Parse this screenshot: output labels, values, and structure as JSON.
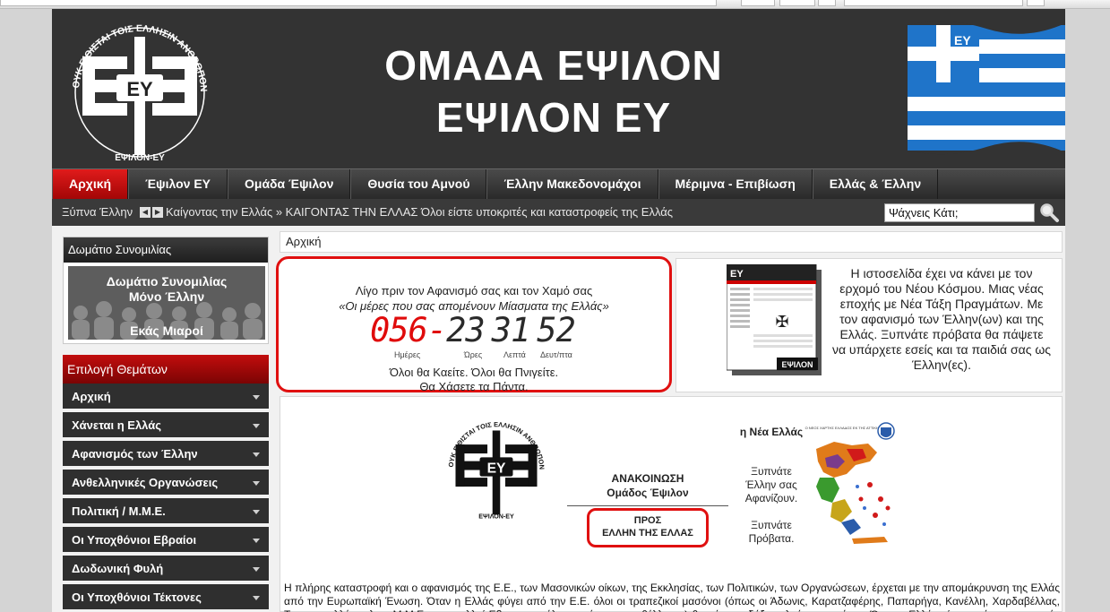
{
  "site": {
    "title_line1": "ΟΜΑΔΑ ΕΨΙΛΟΝ",
    "title_line2": "ΕΨΙΛΟΝ ΕΥ",
    "logo_text": "ΟΥΚ ΕΙΘΙΣΤΑΙ ΤΟΙΣ ΕΛΛΗΣΙΝ ΑΝΘΡΩΠΟΝ ΠΡΟΣΚΥΝΕΕΙ",
    "logo_bottom": "ΕΨΙΛΟΝ-ΕΥ",
    "logo_mark": "ΕΥ",
    "flag_mark": "ΕΥ"
  },
  "colors": {
    "header_bg": "#333333",
    "accent_red": "#d40f0f",
    "flag_blue": "#1f74c9",
    "nav_bg": "#2a2a2a"
  },
  "nav": {
    "items": [
      {
        "label": "Αρχική",
        "active": true
      },
      {
        "label": "Έψιλον ΕΥ",
        "active": false
      },
      {
        "label": "Ομάδα Έψιλον",
        "active": false
      },
      {
        "label": "Θυσία του Αμνού",
        "active": false
      },
      {
        "label": "Έλλην Μακεδονομάχοι",
        "active": false
      },
      {
        "label": "Μέριμνα - Επιβίωση",
        "active": false
      },
      {
        "label": "Ελλάς & Έλλην",
        "active": false
      }
    ]
  },
  "ticker": {
    "label": "Ξύπνα Έλλην",
    "text": "Καίγοντας την Ελλάς » ΚΑΙΓΟΝΤΑΣ ΤΗΝ ΕΛΛΑΣ Όλοι είστε υποκριτές και καταστροφείς της Ελλάς",
    "prev_icon": "arrow-left-icon",
    "next_icon": "arrow-right-icon"
  },
  "search": {
    "value": "Ψάχνεις Κάτι;",
    "icon": "magnifier-icon"
  },
  "chat": {
    "heading": "Δωμάτιο Συνομιλίας",
    "banner_line1": "Δωμάτιο Συνομιλίας",
    "banner_line2": "Μόνο Έλλην",
    "banner_line3": "Εκάς Μιαροί"
  },
  "topics": {
    "heading": "Επιλογή Θεμάτων",
    "items": [
      {
        "label": "Αρχική"
      },
      {
        "label": "Χάνεται η Ελλάς"
      },
      {
        "label": "Αφανισμός των Έλλην"
      },
      {
        "label": "Ανθελληνικές Οργανώσεις"
      },
      {
        "label": "Πολιτική / Μ.Μ.Ε."
      },
      {
        "label": "Οι Υποχθόνιοι Εβραίοι"
      },
      {
        "label": "Δωδωνική Φυλή"
      },
      {
        "label": "Οι Υποχθόνιοι Τέκτονες"
      }
    ]
  },
  "breadcrumb": "Αρχική",
  "countdown": {
    "line1": "Λίγο πριν τον Αφανισμό σας και τον Χαμό σας",
    "line2": "«Οι μέρες που σας απομένουν Μίασματα της Ελλάς»",
    "days": "056",
    "dash": "-",
    "hours": "23",
    "minutes": "31",
    "seconds": "52",
    "unit_days": "Ημέρες",
    "unit_hours": "Ώρες",
    "unit_minutes": "Λεπτά",
    "unit_seconds": "Δευτ/πτα",
    "line3": "Όλοι θα Καείτε. Όλοι θα Πνιγείτε.",
    "line4": "Θα Χάσετε τα Πάντα."
  },
  "intro": {
    "text": "Η ιστοσελίδα έχει να κάνει με τον ερχομό του Νέου Κόσμου. Μιας νέας εποχής με Νέα Τάξη Πραγμάτων. Με τον αφανισμό των Έλλην(ων) και της Ελλάς. Ξυπνάτε πρόβατα θα πάψετε να υπάρχετε εσείς και τα παιδιά σας ως Έλλην(ες).",
    "thumb_label": "ΕΨΙΛΟΝ",
    "thumb_mark": "ΕΥ"
  },
  "announcement": {
    "title": "ΑΝΑΚΟΙΝΩΣΗ",
    "subtitle": "Ομάδος Έψιλον",
    "to_line1": "ΠΡΟΣ",
    "to_line2": "ΕΛΛΗΝ ΤΗΣ ΕΛΛΑΣ"
  },
  "map_side": {
    "line1": "η Νέα Ελλάς",
    "line2": "Ξυπνάτε Έλλην σας Αφανίζουν.",
    "line3": "Ξυπνάτε Πρόβατα.",
    "map_caption": "Ο ΝΕΟΣ ΧΑΡΤΗΣ ΕΛΛΑΔΟΣ ΕΚ ΤΗΣ ΑΤΤΙΚΗΣ"
  },
  "article": "Η πλήρης καταστροφή και ο αφανισμός της Ε.Ε., των Μασονικών οίκων, της Εκκλησίας, των Πολιτικών, των Οργανώσεων, έρχεται με την απομάκρυνση της Ελλάς από την Ευρωπαϊκή Ένωση. Όταν η Ελλάς φύγει από την Ε.Ε. όλοι οι τραπεζικοί μασόνοι (όπως οι Άδωνις, Καρατζαφέρης, Παπαρήγα, Κανέλλη, Χαρδαβέλλας, Τριανταφυλλόπουλος, Μ.Μ.Ε. κ.α. πολλοί Εβραιομογγόλοι μασόνοι και ανθέλληνες) θα χάσουν δόξα, πλούτη, τα πάντα. Όταν η Ελλάς γίνει αυτόνομη και εκτός Ε.Ε."
}
